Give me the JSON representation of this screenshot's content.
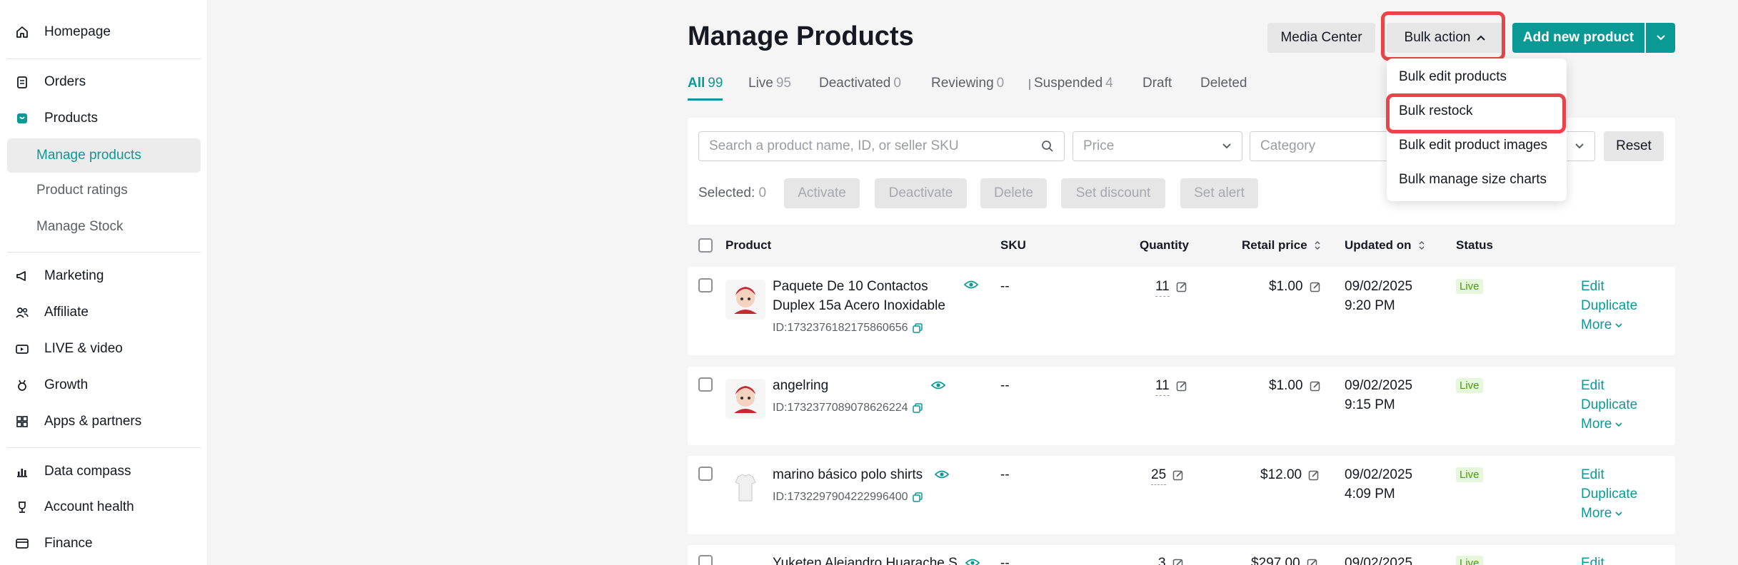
{
  "sidebar": {
    "items": [
      {
        "label": "Homepage",
        "icon": "home-icon"
      },
      {
        "label": "Orders",
        "icon": "clipboard-icon"
      },
      {
        "label": "Products",
        "icon": "bag-icon"
      },
      {
        "label": "Marketing",
        "icon": "megaphone-icon"
      },
      {
        "label": "Affiliate",
        "icon": "users-icon"
      },
      {
        "label": "LIVE & video",
        "icon": "video-icon"
      },
      {
        "label": "Growth",
        "icon": "medal-icon"
      },
      {
        "label": "Apps & partners",
        "icon": "apps-icon"
      },
      {
        "label": "Data compass",
        "icon": "chart-icon"
      },
      {
        "label": "Account health",
        "icon": "trophy-icon"
      },
      {
        "label": "Finance",
        "icon": "wallet-icon"
      }
    ],
    "products_sub": [
      "Manage products",
      "Product ratings",
      "Manage Stock"
    ]
  },
  "header": {
    "title": "Manage Products",
    "media_center": "Media Center",
    "bulk_action": "Bulk action",
    "add_new": "Add new product"
  },
  "tabs": [
    {
      "label": "All",
      "count": "99"
    },
    {
      "label": "Live",
      "count": "95"
    },
    {
      "label": "Deactivated",
      "count": "0"
    },
    {
      "label": "Reviewing",
      "count": "0"
    },
    {
      "label": "Suspended",
      "count": "4"
    },
    {
      "label": "Draft",
      "count": ""
    },
    {
      "label": "Deleted",
      "count": ""
    }
  ],
  "filters": {
    "search_placeholder": "Search a product name, ID, or seller SKU",
    "price_placeholder": "Price",
    "category_placeholder": "Category",
    "reset": "Reset"
  },
  "selection": {
    "label": "Selected:",
    "count": "0",
    "actions": [
      "Activate",
      "Deactivate",
      "Delete",
      "Set discount",
      "Set alert"
    ]
  },
  "table": {
    "headers": {
      "product": "Product",
      "sku": "SKU",
      "quantity": "Quantity",
      "retail_price": "Retail price",
      "updated_on": "Updated on",
      "status": "Status"
    },
    "rows": [
      {
        "name": "Paquete De 10 Contactos Duplex 15a Acero Inoxidable",
        "id": "ID:1732376182175860656",
        "sku": "--",
        "quantity": "11",
        "price": "$1.00",
        "date": "09/02/2025",
        "time": "9:20 PM",
        "status": "Live"
      },
      {
        "name": "angelring",
        "id": "ID:1732377089078626224",
        "sku": "--",
        "quantity": "11",
        "price": "$1.00",
        "date": "09/02/2025",
        "time": "9:15 PM",
        "status": "Live"
      },
      {
        "name": "marino básico polo shirts",
        "id": "ID:1732297904222996400",
        "sku": "--",
        "quantity": "25",
        "price": "$12.00",
        "date": "09/02/2025",
        "time": "4:09 PM",
        "status": "Live"
      },
      {
        "name": "Yuketen Alejandro Huarache S...",
        "id": "",
        "sku": "--",
        "quantity": "3",
        "price": "$297.00",
        "date": "09/02/2025",
        "time": "",
        "status": "Live"
      }
    ],
    "row_actions": {
      "edit": "Edit",
      "duplicate": "Duplicate",
      "more": "More"
    }
  },
  "bulk_menu": {
    "items": [
      "Bulk edit products",
      "Bulk restock",
      "Bulk edit product images",
      "Bulk manage size charts"
    ]
  },
  "colors": {
    "accent": "#0a9a96",
    "highlight": "#e8444a",
    "live_bg": "#e7f7dc",
    "live_text": "#4a9b14"
  }
}
